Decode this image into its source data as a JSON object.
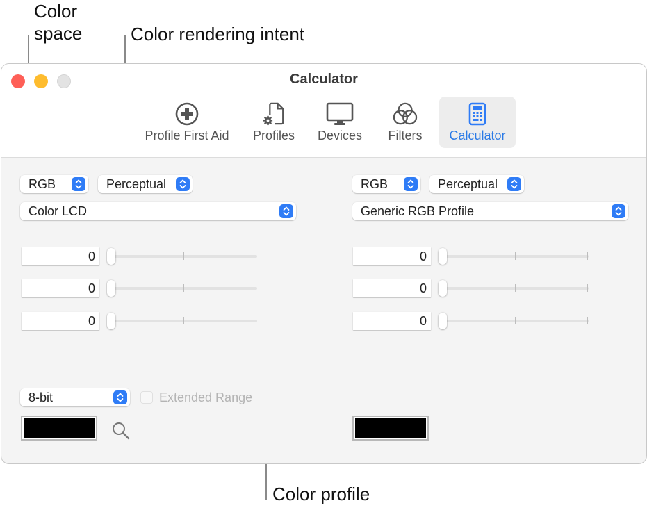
{
  "callouts": {
    "color_space_line1": "Color",
    "color_space_line2": "space",
    "rendering_intent": "Color rendering intent",
    "color_profile": "Color profile"
  },
  "window": {
    "title": "Calculator",
    "traffic_lights": {
      "close": "#fe5f57",
      "minimize": "#febc2e",
      "zoom": "#e0e0e0"
    },
    "toolbar": [
      {
        "label": "Profile First Aid",
        "icon": "plus-circle-icon",
        "active": false
      },
      {
        "label": "Profiles",
        "icon": "document-gear-icon",
        "active": false
      },
      {
        "label": "Devices",
        "icon": "display-icon",
        "active": false
      },
      {
        "label": "Filters",
        "icon": "overlapping-circles-icon",
        "active": false
      },
      {
        "label": "Calculator",
        "icon": "calculator-icon",
        "active": true
      }
    ],
    "accent_color": "#2a7ae6"
  },
  "left": {
    "color_space": "RGB",
    "rendering_intent": "Perceptual",
    "profile": "Color LCD",
    "channels": [
      {
        "value": "0",
        "slider_fraction": 0
      },
      {
        "value": "0",
        "slider_fraction": 0
      },
      {
        "value": "0",
        "slider_fraction": 0
      }
    ],
    "bit_depth": "8-bit",
    "extended_range_label": "Extended Range",
    "extended_range_checked": false,
    "swatch_color": "#000000"
  },
  "right": {
    "color_space": "RGB",
    "rendering_intent": "Perceptual",
    "profile": "Generic RGB Profile",
    "channels": [
      {
        "value": "0",
        "slider_fraction": 0
      },
      {
        "value": "0",
        "slider_fraction": 0
      },
      {
        "value": "0",
        "slider_fraction": 0
      }
    ],
    "swatch_color": "#000000"
  }
}
